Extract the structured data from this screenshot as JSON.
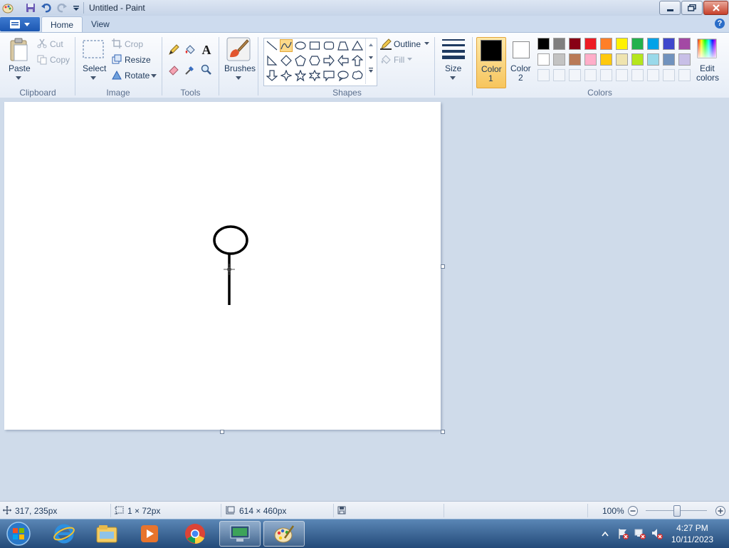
{
  "window": {
    "title": "Untitled - Paint",
    "qat_icons": [
      "paint-app-icon",
      "save-icon",
      "undo-icon",
      "redo-icon",
      "customize-qat-icon"
    ],
    "controls": [
      "minimize-icon",
      "maximize-icon",
      "close-icon"
    ]
  },
  "tabs": {
    "home": "Home",
    "view": "View",
    "help_glyph": "?"
  },
  "clipboard": {
    "paste": "Paste",
    "cut": "Cut",
    "copy": "Copy",
    "group": "Clipboard"
  },
  "image": {
    "select": "Select",
    "crop": "Crop",
    "resize": "Resize",
    "rotate": "Rotate",
    "group": "Image"
  },
  "tools": {
    "text_glyph": "A",
    "group": "Tools"
  },
  "brushes": {
    "label": "Brushes"
  },
  "shapes": {
    "outline": "Outline",
    "fill": "Fill",
    "group": "Shapes",
    "selected": "curve"
  },
  "size": {
    "label": "Size"
  },
  "colors": {
    "color1_label_a": "Color",
    "color1_label_b": "1",
    "color2_label_a": "Color",
    "color2_label_b": "2",
    "edit_label_a": "Edit",
    "edit_label_b": "colors",
    "group": "Colors",
    "color1": "#000000",
    "color2": "#ffffff",
    "palette_row1": [
      "#000000",
      "#7f7f7f",
      "#880015",
      "#ed1c24",
      "#ff7f27",
      "#fff200",
      "#22b14c",
      "#00a2e8",
      "#3f48cc",
      "#a349a4"
    ],
    "palette_row2": [
      "#ffffff",
      "#c3c3c3",
      "#b97a57",
      "#ffaec9",
      "#ffc90e",
      "#efe4b0",
      "#b5e61d",
      "#99d9ea",
      "#7092be",
      "#c8bfe7"
    ]
  },
  "status": {
    "cursor_pos": "317, 235px",
    "selection_size": "1 × 72px",
    "image_size": "614 × 460px",
    "zoom": "100%"
  },
  "taskbar": {
    "items": [
      "start-button",
      "internet-explorer-icon",
      "file-explorer-icon",
      "media-player-icon",
      "chrome-icon",
      "remote-desktop-icon",
      "paint-icon"
    ],
    "time": "4:27 PM",
    "date": "10/11/2023"
  }
}
